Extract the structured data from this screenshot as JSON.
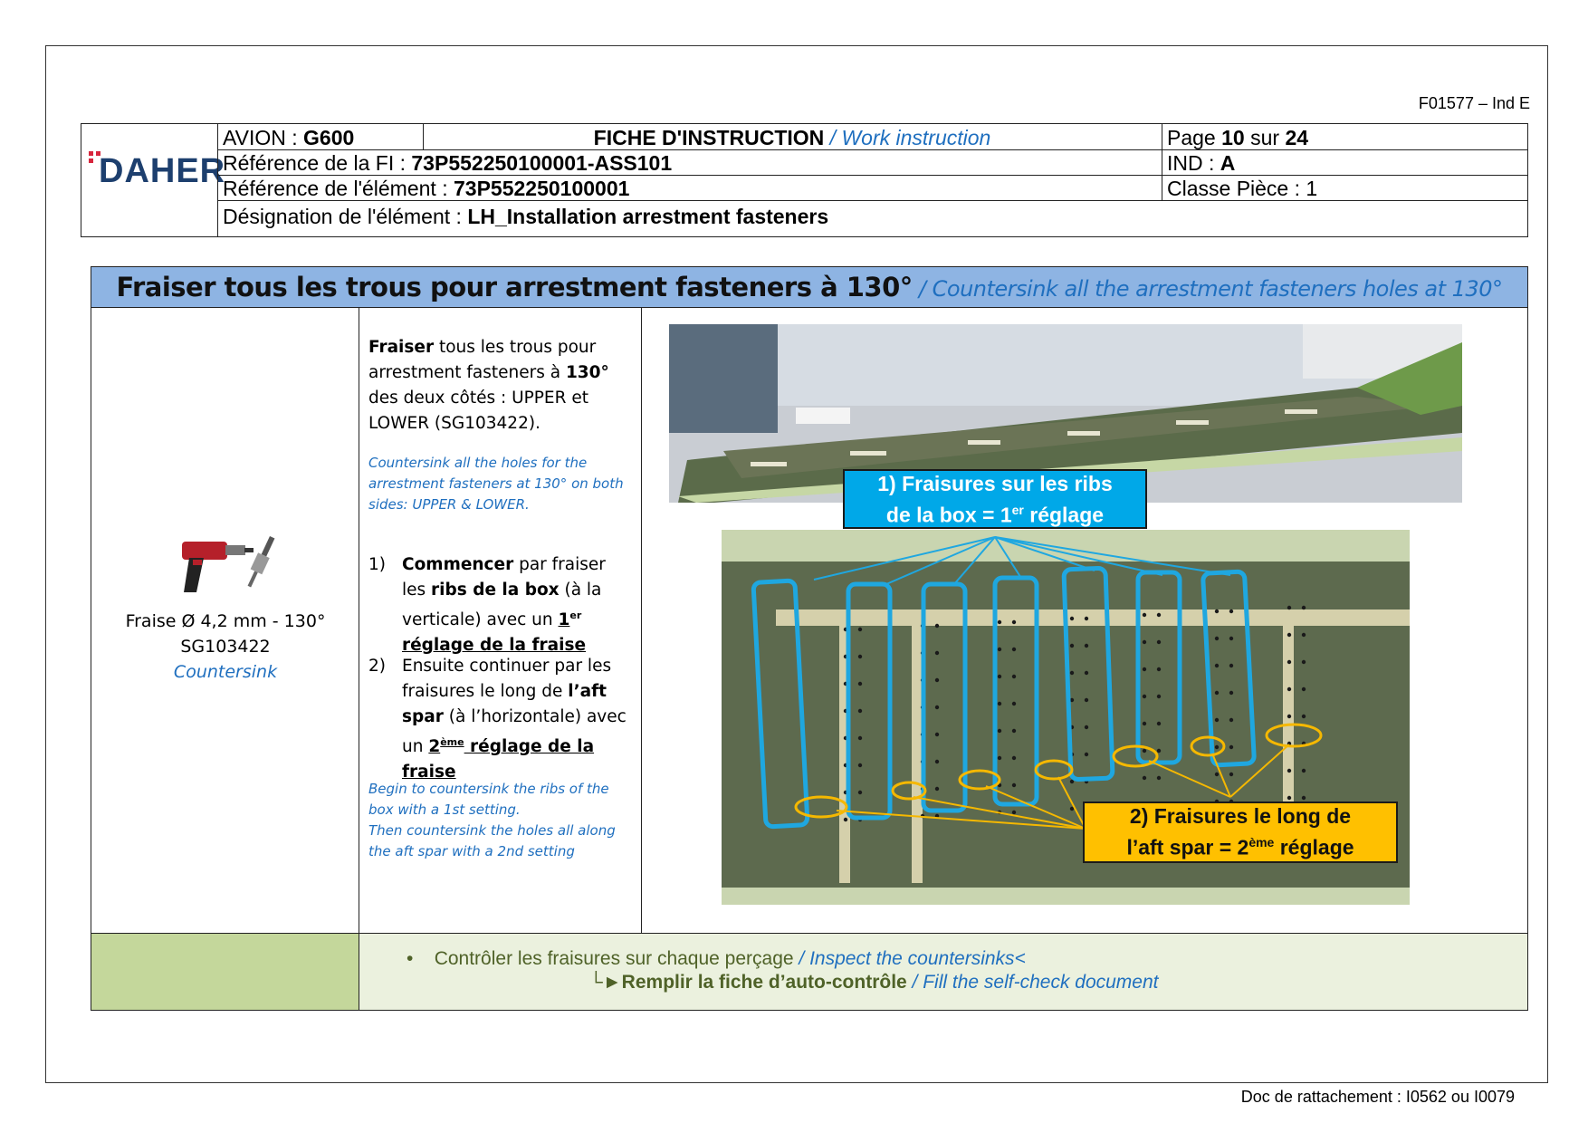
{
  "doc": {
    "form_ref": "F01577 – Ind E",
    "attachment_ref": "Doc de rattachement : I0562 ou I0079"
  },
  "header": {
    "logo_text": "DAHER",
    "avion_label": "AVION : ",
    "avion_value": "G600",
    "fiche_fr": "FICHE D'INSTRUCTION",
    "fiche_en": " / Work instruction",
    "page_label": "Page ",
    "page_num": "10",
    "page_sur": " sur ",
    "page_total": "24",
    "ref_fi_label": "Référence de la FI : ",
    "ref_fi_value": "73P552250100001-ASS101",
    "ind_label": "IND : ",
    "ind_value": "A",
    "ref_elem_label": "Référence de l'élément : ",
    "ref_elem_value": "73P552250100001",
    "classe_label": "Classe Pièce : 1",
    "design_label": "Désignation de l'élément : ",
    "design_value": "LH_Installation arrestment fasteners"
  },
  "step": {
    "title_fr": "Fraiser tous les trous pour arrestment fasteners à 130°",
    "title_en": " / Countersink all the arrestment fasteners holes at 130°"
  },
  "tool": {
    "line1": "Fraise Ø 4,2 mm - 130°",
    "line2": "SG103422",
    "line3": "Countersink"
  },
  "instructions": {
    "intro_bold1": "Fraiser",
    "intro_1": " tous les trous pour arrestment fasteners à ",
    "intro_bold2": "130°",
    "intro_2": " des deux côtés : UPPER et LOWER (SG103422).",
    "intro_en": "Countersink all the holes for the arrestment fasteners at 130° on both sides: UPPER & LOWER.",
    "s1_num": "1)",
    "s1_bold1": "Commencer",
    "s1_t1": " par fraiser les ",
    "s1_bold2": "ribs de la box",
    "s1_t2": " (à la verticale) avec un ",
    "s1_u1": "1",
    "s1_sup": "er",
    "s1_u2": "réglage de la fraise",
    "s2_num": "2)",
    "s2_t1": "Ensuite continuer par les fraisures le long de ",
    "s2_bold1": "l’aft spar",
    "s2_t2": " (à l’horizontale) avec un ",
    "s2_u1": "2",
    "s2_sup": "ème",
    "s2_u2": " réglage de la fraise",
    "en_1": "Begin to countersink the ribs of the box with a 1st setting.",
    "en_2": "Then countersink the holes all along the aft spar with a 2nd setting"
  },
  "callouts": {
    "c1_line1": "1)  Fraisures sur les ribs",
    "c1_line2a": "de la box = 1",
    "c1_sup": "er",
    "c1_line2b": " réglage",
    "c2_line1": "2)  Fraisures le long de",
    "c2_line2a": "l’aft spar = 2",
    "c2_sup": "ème",
    "c2_line2b": " réglage"
  },
  "check": {
    "bullet": "•",
    "fr": "Contrôler les fraisures sur chaque perçage",
    "en": " / Inspect the countersinks<",
    "arrow": "└►",
    "fill_fr": "Remplir la fiche d’auto-contrôle",
    "fill_en": " / Fill the self-check document"
  },
  "colors": {
    "title_bar": "#8eb4e3",
    "callout_blue": "#00a8e8",
    "callout_yellow": "#ffc000",
    "highlight_blue": "#1fa7e0",
    "highlight_yellow": "#f5b800",
    "footer_green": "#c4d79b",
    "footer_light": "#ebf1de",
    "brand": "#1d3f6e"
  }
}
